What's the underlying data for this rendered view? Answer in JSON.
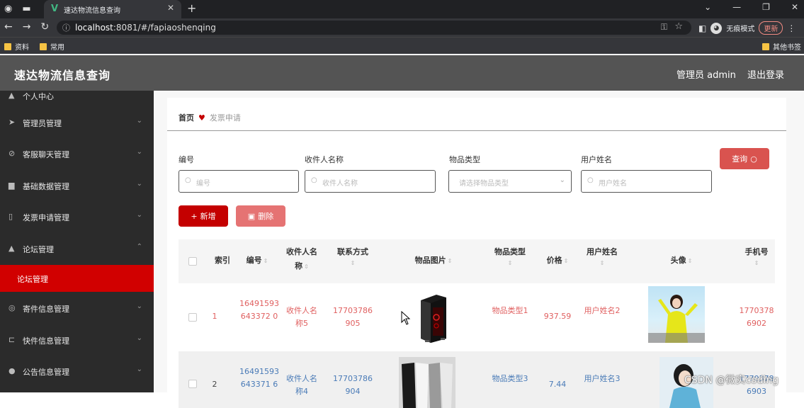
{
  "browser": {
    "tab_title": "速达物流信息查询",
    "url_host": "localhost",
    "url_rest": ":8081/#/fapiaoshenqing",
    "incognito_label": "无痕模式",
    "update_label": "更新",
    "bookmarks": [
      "资料",
      "常用"
    ],
    "other_bookmarks": "其他书签"
  },
  "header": {
    "title": "速达物流信息查询",
    "admin": "管理员 admin",
    "logout": "退出登录"
  },
  "sidebar": {
    "items": [
      {
        "label": "个人中心"
      },
      {
        "label": "管理员管理"
      },
      {
        "label": "客服聊天管理"
      },
      {
        "label": "基础数据管理"
      },
      {
        "label": "发票申请管理"
      },
      {
        "label": "论坛管理"
      },
      {
        "label": "论坛管理"
      },
      {
        "label": "寄件信息管理"
      },
      {
        "label": "快件信息管理"
      },
      {
        "label": "公告信息管理"
      }
    ]
  },
  "breadcrumb": {
    "home": "首页",
    "current": "发票申请"
  },
  "filters": {
    "code_label": "编号",
    "code_placeholder": "编号",
    "recipient_label": "收件人名称",
    "recipient_placeholder": "收件人名称",
    "type_label": "物品类型",
    "type_placeholder": "请选择物品类型",
    "user_label": "用户姓名",
    "user_placeholder": "用户姓名",
    "search_button": "查询"
  },
  "actions": {
    "add": "新增",
    "delete": "删除"
  },
  "table": {
    "headers": {
      "index": "索引",
      "code": "编号",
      "recipient": "收件人名称",
      "phone": "联系方式",
      "image": "物品图片",
      "type": "物品类型",
      "price": "价格",
      "user": "用户姓名",
      "avatar": "头像",
      "mobile": "手机号"
    },
    "rows": [
      {
        "index": "1",
        "code": "16491593643372 0",
        "recipient": "收件人名称5",
        "phone": "17703786905",
        "type": "物品类型1",
        "price": "937.59",
        "user": "用户姓名2",
        "mobile": "17703786902"
      },
      {
        "index": "2",
        "code": "16491593643371 6",
        "recipient": "收件人名称4",
        "phone": "17703786904",
        "type": "物品类型3",
        "price": "7.44",
        "user": "用户姓名3",
        "mobile": "17703786903"
      }
    ]
  },
  "watermark": "CSDN @微实coding",
  "colors": {
    "accent_red": "#c40000",
    "sidebar_bg": "#2b2b2b",
    "header_bg": "#545454",
    "link_red": "#e06060",
    "link_blue": "#4a7bb7"
  }
}
